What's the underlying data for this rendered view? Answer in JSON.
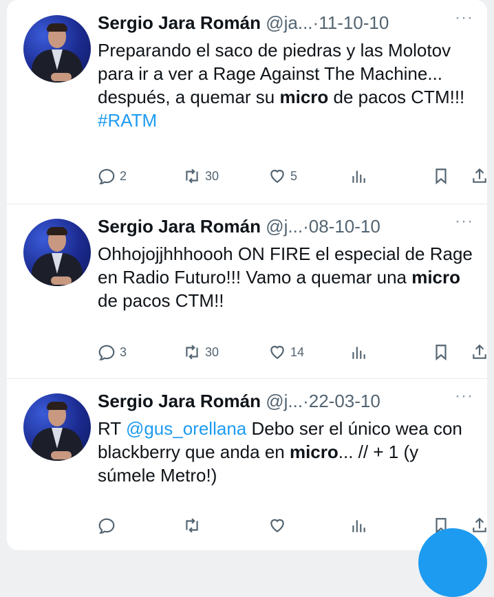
{
  "tweets": [
    {
      "name": "Sergio Jara Román",
      "handle": "@ja...",
      "sep": "·",
      "date": "11-10-10",
      "text_parts": [
        {
          "t": "Preparando el saco de piedras y las Molotov para ir a ver a Rage Against The Machine... después, a quemar su "
        },
        {
          "t": "micro",
          "bold": true
        },
        {
          "t": " de pacos CTM!!! "
        },
        {
          "t": "#RATM",
          "link": true
        }
      ],
      "replies": "2",
      "retweets": "30",
      "likes": "5"
    },
    {
      "name": "Sergio Jara Román",
      "handle": "@j...",
      "sep": "·",
      "date": "08-10-10",
      "text_parts": [
        {
          "t": "Ohhojojjhhhoooh ON FIRE el especial de Rage en Radio Futuro!!! Vamo a quemar una "
        },
        {
          "t": "micro",
          "bold": true
        },
        {
          "t": " de pacos CTM!!"
        }
      ],
      "replies": "3",
      "retweets": "30",
      "likes": "14"
    },
    {
      "name": "Sergio Jara Román",
      "handle": "@j...",
      "sep": "·",
      "date": "22-03-10",
      "text_parts": [
        {
          "t": "RT "
        },
        {
          "t": "@gus_orellana",
          "link": true
        },
        {
          "t": " Debo ser el único wea con blackberry que anda en "
        },
        {
          "t": "micro",
          "bold": true
        },
        {
          "t": "... // + 1 (y súmele Metro!)"
        }
      ],
      "replies": "",
      "retweets": "",
      "likes": ""
    }
  ],
  "more_label": "···",
  "colors": {
    "accent": "#1d9bf0",
    "muted": "#536471",
    "text": "#0f1419"
  },
  "icons": [
    "reply-icon",
    "retweet-icon",
    "like-icon",
    "views-icon",
    "bookmark-icon",
    "share-icon"
  ]
}
